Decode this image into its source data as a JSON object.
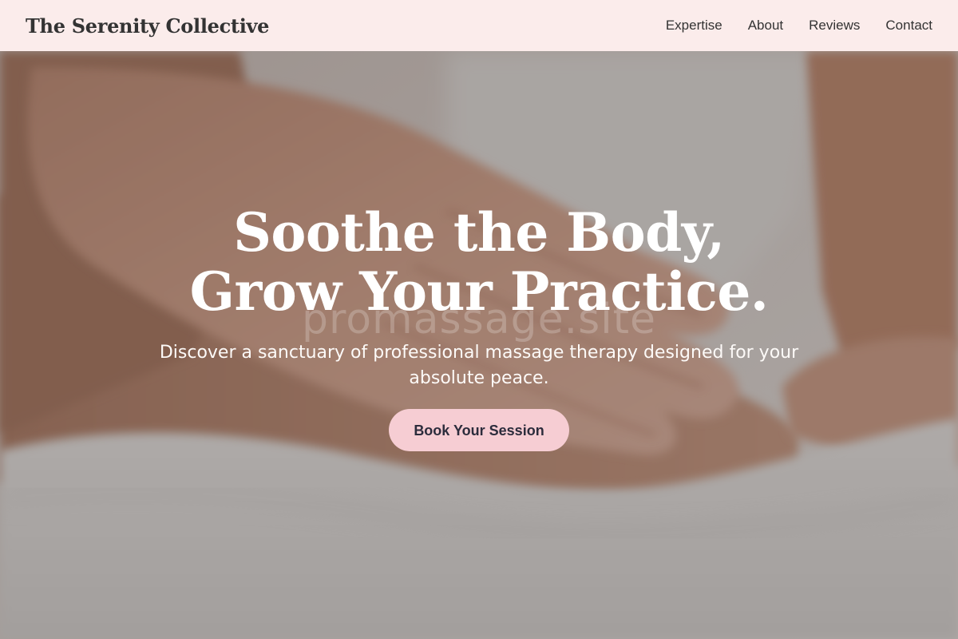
{
  "header": {
    "brand": "The Serenity Collective",
    "nav": [
      {
        "label": "Expertise"
      },
      {
        "label": "About"
      },
      {
        "label": "Reviews"
      },
      {
        "label": "Contact"
      }
    ]
  },
  "hero": {
    "title": "Soothe the Body, Grow Your Practice.",
    "subtitle": "Discover a sanctuary of professional massage therapy designed for your absolute peace.",
    "cta_label": "Book Your Session",
    "watermark": "promassage.site",
    "background_image": "massage-hands-on-back-photo"
  },
  "colors": {
    "header_bg": "#fbeceb",
    "cta_bg": "#f6cdd3",
    "cta_text": "#2c2c3c",
    "brand_text": "#333333",
    "hero_text": "#ffffff"
  }
}
